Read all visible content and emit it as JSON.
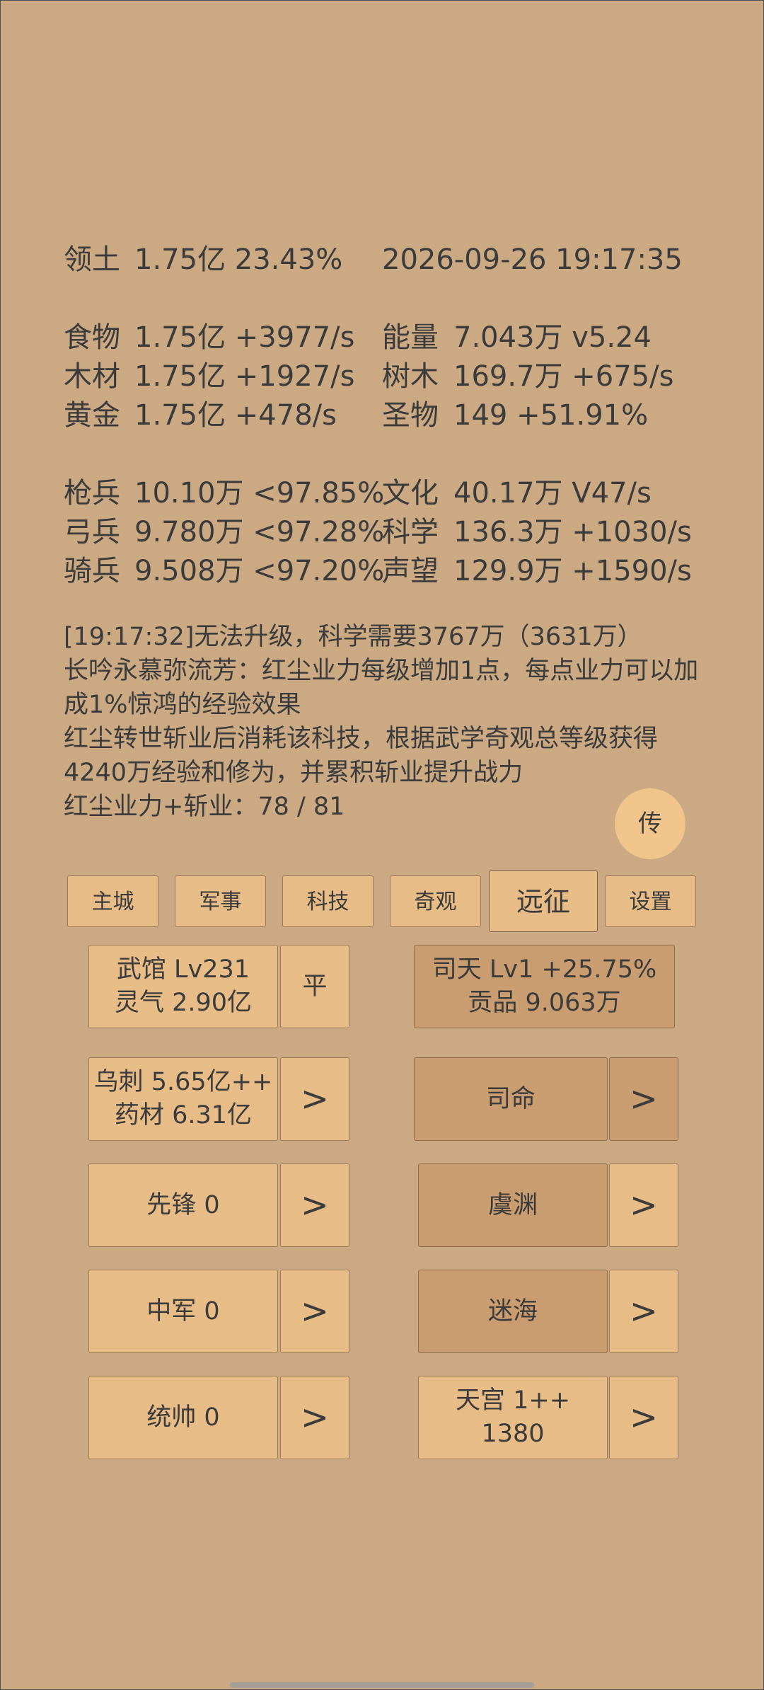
{
  "stats": {
    "territory": {
      "label": "领土",
      "value": "1.75亿  23.43%"
    },
    "datetime": "2026-09-26 19:17:35",
    "food": {
      "label": "食物",
      "value": "1.75亿 +3977/s"
    },
    "energy": {
      "label": "能量",
      "value": "7.043万  v5.24"
    },
    "wood": {
      "label": "木材",
      "value": "1.75亿 +1927/s"
    },
    "trees": {
      "label": "树木",
      "value": "169.7万 +675/s"
    },
    "gold": {
      "label": "黄金",
      "value": "1.75亿 +478/s"
    },
    "relic": {
      "label": "圣物",
      "value": "149 +51.91%"
    },
    "spearman": {
      "label": "枪兵",
      "value": "10.10万 <97.85%"
    },
    "culture": {
      "label": "文化",
      "value": "40.17万 V47/s"
    },
    "archer": {
      "label": "弓兵",
      "value": "9.780万 <97.28%"
    },
    "science": {
      "label": "科学",
      "value": "136.3万 +1030/s"
    },
    "cavalry": {
      "label": "骑兵",
      "value": "9.508万 <97.20%"
    },
    "prestige": {
      "label": "声望",
      "value": "129.9万 +1590/s"
    }
  },
  "log": {
    "line1": "[19:17:32]无法升级，科学需要3767万（3631万）",
    "line2": "长吟永慕弥流芳：红尘业力每级增加1点，每点业力可以加成1%惊鸿的经验效果",
    "line3": "红尘转世斩业后消耗该科技，根据武学奇观总等级获得4240万经验和修为，并累积斩业提升战力",
    "line4": "红尘业力+斩业：78 / 81"
  },
  "chuan_button": "传",
  "tabs": [
    "主城",
    "军事",
    "科技",
    "奇观",
    "远征",
    "设置"
  ],
  "active_tab": "远征",
  "left": {
    "wuguan": {
      "line1": "武馆 Lv231",
      "line2": "灵气 2.90亿",
      "side": "平"
    },
    "wuci": {
      "line1": "乌刺  5.65亿++",
      "line2": "药材 6.31亿",
      "side": ">"
    },
    "xianfeng": {
      "label": "先锋  0",
      "side": ">"
    },
    "zhongjun": {
      "label": "中军  0",
      "side": ">"
    },
    "tongshuai": {
      "label": "统帅  0",
      "side": ">"
    }
  },
  "right": {
    "sitian": {
      "line1": "司天 Lv1 +25.75%",
      "line2": "贡品 9.063万"
    },
    "siming": {
      "label": "司命",
      "side": ">"
    },
    "yuyuan": {
      "label": "虞渊",
      "side": ">"
    },
    "mihai": {
      "label": "迷海",
      "side": ">"
    },
    "tiangong": {
      "line1": "天宫  1++",
      "line2": "1380",
      "side": ">"
    }
  }
}
